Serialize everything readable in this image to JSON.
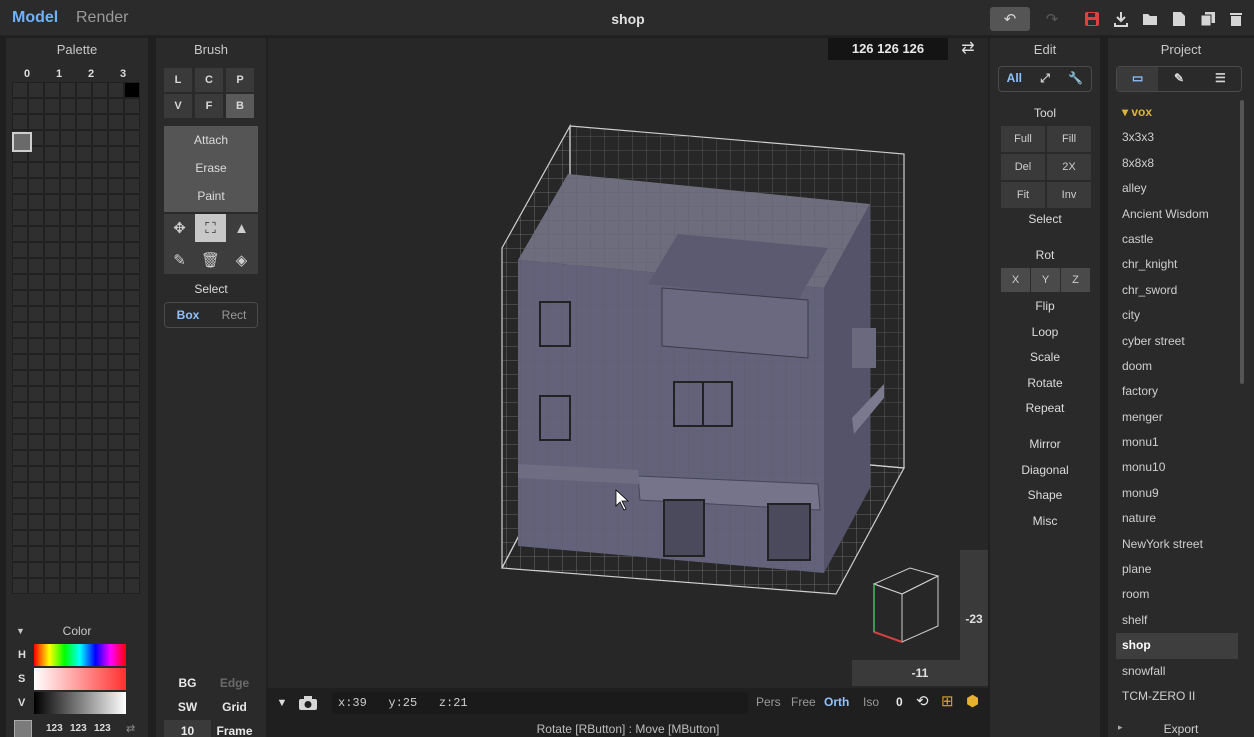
{
  "app": {
    "modes": [
      "Model",
      "Render"
    ],
    "title": "shop"
  },
  "toolbar": {
    "icons": [
      "undo-icon",
      "redo-icon",
      "save-icon",
      "import-icon",
      "open-folder-icon",
      "new-file-icon",
      "copy-icon",
      "delete-icon"
    ],
    "accent_color": "#6fb2ff",
    "save_color": "#e04040"
  },
  "palette": {
    "title": "Palette",
    "columns": [
      "0",
      "1",
      "2",
      "3"
    ]
  },
  "color": {
    "title": "Color",
    "labels": [
      "H",
      "S",
      "V"
    ],
    "rgb": [
      "123",
      "123",
      "123"
    ]
  },
  "brush": {
    "title": "Brush",
    "row1": [
      "L",
      "C",
      "P"
    ],
    "row2": [
      "V",
      "F",
      "B"
    ],
    "modes": [
      "Attach",
      "Erase",
      "Paint"
    ],
    "select_label": "Select",
    "box_label": "Box",
    "rect_label": "Rect",
    "bg_label": "BG",
    "edge_label": "Edge",
    "sw_label": "SW",
    "grid_label": "Grid",
    "frame_value": "10",
    "frame_label": "Frame"
  },
  "viewport": {
    "dimensions": "126  126  126",
    "axis_label_right": "-23",
    "axis_label_bottom": "-11",
    "coords": "x:39   y:25   z:21",
    "view_modes": [
      "Pers",
      "Free",
      "Orth",
      "Iso"
    ],
    "zero": "0",
    "hint": "Rotate [RButton] : Move [MButton]"
  },
  "edit": {
    "title": "Edit",
    "filter_all": "All",
    "tool_label": "Tool",
    "tool_buttons": [
      "Full",
      "Fill",
      "Del",
      "2X",
      "Fit",
      "Inv"
    ],
    "select_label": "Select",
    "rot_label": "Rot",
    "axes": [
      "X",
      "Y",
      "Z"
    ],
    "actions": [
      "Flip",
      "Loop",
      "Scale",
      "Rotate",
      "Repeat"
    ],
    "actions2": [
      "Mirror",
      "Diagonal",
      "Shape",
      "Misc"
    ]
  },
  "project": {
    "title": "Project",
    "folder": "vox",
    "items": [
      "3x3x3",
      "8x8x8",
      "alley",
      "Ancient Wisdom",
      "castle",
      "chr_knight",
      "chr_sword",
      "city",
      "cyber street",
      "doom",
      "factory",
      "menger",
      "monu1",
      "monu10",
      "monu9",
      "nature",
      "NewYork street",
      "plane",
      "room",
      "shelf",
      "shop",
      "snowfall",
      "TCM-ZERO II"
    ],
    "selected": "shop",
    "export_label": "Export"
  }
}
